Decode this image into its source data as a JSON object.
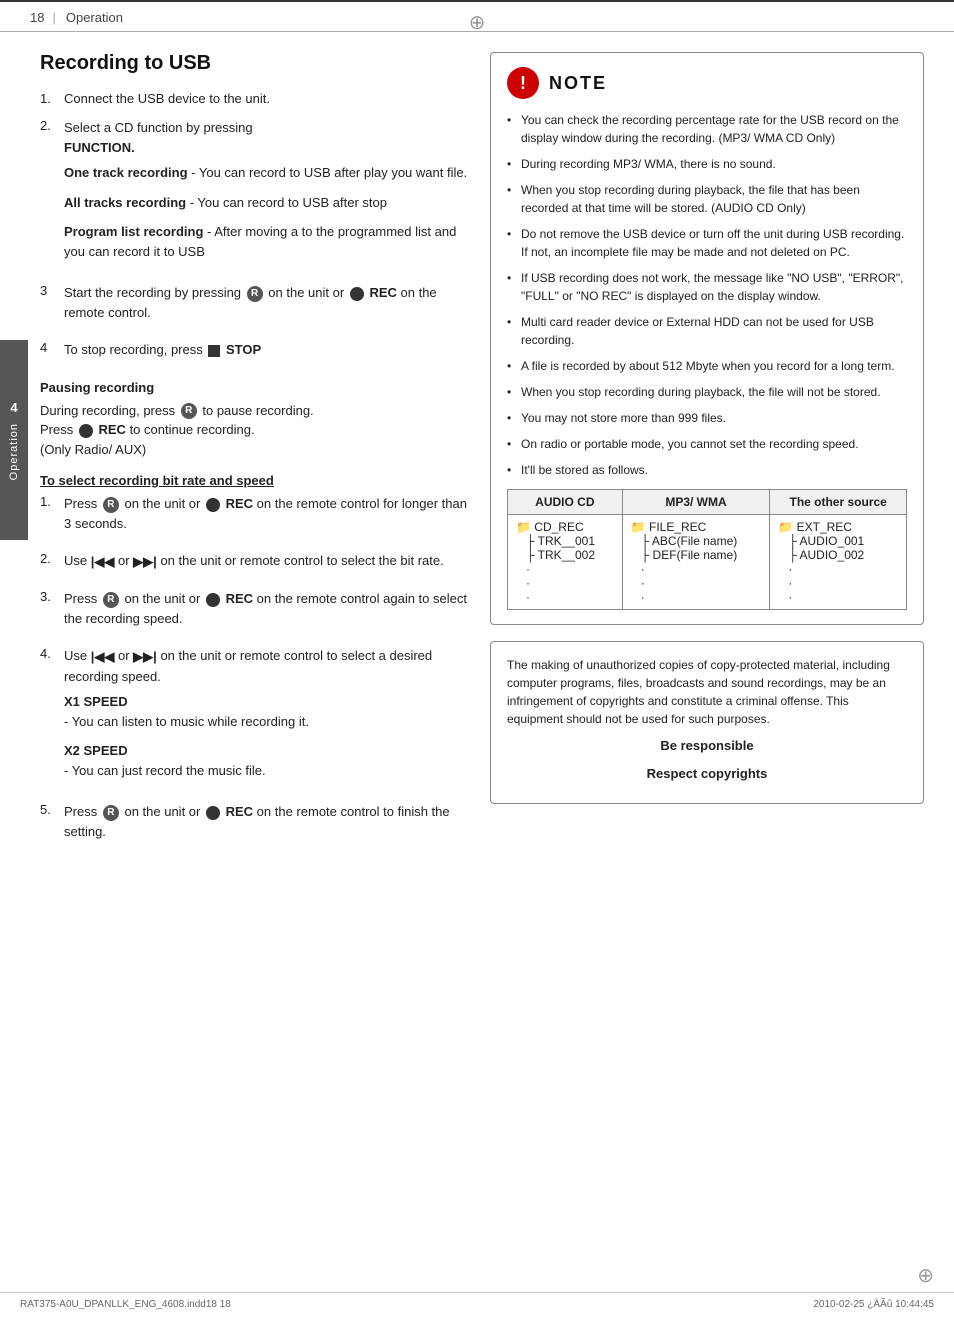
{
  "header": {
    "page_num": "18",
    "title": "Operation"
  },
  "sidebar": {
    "chapter_num": "4",
    "chapter_label": "Operation"
  },
  "left_col": {
    "section_title": "Recording to USB",
    "steps": [
      {
        "num": "1.",
        "text": "Connect the USB device to the unit."
      },
      {
        "num": "2.",
        "text": "Select a CD function by pressing",
        "bold": "FUNCTION.",
        "sub_items": [
          {
            "label": "One track recording",
            "desc": " - You can record to USB after play you want file."
          },
          {
            "label": "All tracks recording",
            "desc": " - You can record to USB after stop"
          },
          {
            "label": "Program list recording",
            "desc": " - After moving a to the programmed list and you can record it to USB"
          }
        ]
      },
      {
        "num": "3",
        "text_before": "Start the recording by pressing",
        "icon": "R",
        "text_after": "on the unit or",
        "icon2": "●",
        "bold2": "REC",
        "text_end": "on the remote control."
      },
      {
        "num": "4",
        "text_before": "To stop recording, press",
        "icon": "■",
        "bold": "STOP"
      }
    ],
    "pausing_heading": "Pausing recording",
    "pausing_text1_before": "During recording, press",
    "pausing_icon": "R",
    "pausing_text1_after": "to pause recording.",
    "pausing_text2_before": "Press",
    "pausing_icon2": "●",
    "pausing_bold2": "REC",
    "pausing_text2_after": "to continue recording.",
    "pausing_text3": "(Only Radio/ AUX)",
    "bitrate_heading": "To select recording bit rate and speed",
    "bitrate_steps": [
      {
        "num": "1.",
        "text_before": "Press",
        "icon": "R",
        "text_mid": "on the unit or",
        "icon2": "●",
        "bold2": "REC",
        "text_after": "on the remote control for longer than 3 seconds."
      },
      {
        "num": "2.",
        "text_before": "Use",
        "icon_skip1": "◀◀",
        "text_mid": "or",
        "icon_skip2": "▶▶",
        "text_after": "on the unit or remote control to select the bit rate."
      },
      {
        "num": "3.",
        "text_before": "Press",
        "icon": "R",
        "text_mid": "on the unit or",
        "icon2": "●",
        "bold2": "REC",
        "text_after": "on the remote control again to select the recording speed."
      },
      {
        "num": "4.",
        "text_before": "Use",
        "icon_skip1": "◀◀",
        "text_mid": "or",
        "icon_skip2": "▶▶",
        "text_after": "on the unit or remote control to select a desired recording speed.",
        "sub": [
          {
            "label": "X1 SPEED",
            "desc": "- You can listen to music while recording it."
          },
          {
            "label": "X2 SPEED",
            "desc": "- You can just record the music file."
          }
        ]
      },
      {
        "num": "5.",
        "text_before": "Press",
        "icon": "R",
        "text_mid": "on the unit or",
        "icon2": "●",
        "bold2": "REC",
        "text_after": "on the remote control to finish the setting."
      }
    ]
  },
  "note_box": {
    "title": "NOTE",
    "items": [
      "You can check the recording percentage rate for the USB record on the display window during the recording. (MP3/ WMA CD Only)",
      "During recording MP3/ WMA, there is no sound.",
      "When you stop recording during playback, the file that has been recorded at that time will be stored. (AUDIO CD Only)",
      "Do not remove the USB device or turn off the unit during USB recording. If not, an incomplete file may be made and not deleted on PC.",
      "If USB recording does not work, the message like \"NO USB\", \"ERROR\", \"FULL\" or \"NO REC\" is displayed on the display window.",
      "Multi card reader device or External HDD can not be used for USB recording.",
      "A file is recorded by about 512 Mbyte when you record for a long term.",
      "When you stop recording during playback, the file will not be stored.",
      "You may not store more than 999 files.",
      "On radio or portable mode, you cannot set the recording speed.",
      "It'll be stored as follows."
    ]
  },
  "file_table": {
    "headers": [
      "AUDIO CD",
      "MP3/ WMA",
      "The other source"
    ],
    "rows": [
      {
        "col1_folder": "CD_REC",
        "col1_items": [
          "TRK__001",
          "TRK__002",
          "·",
          "·",
          "·"
        ],
        "col2_folder": "FILE_REC",
        "col2_items": [
          "ABC(File name)",
          "DEF(File name)",
          "·",
          "·",
          "·"
        ],
        "col3_folder": "EXT_REC",
        "col3_items": [
          "AUDIO_001",
          "AUDIO_002",
          "·",
          "·",
          "·"
        ]
      }
    ]
  },
  "copyright_box": {
    "text": "The making of unauthorized copies of copy-protected material, including computer programs, files, broadcasts and sound recordings, may be an infringement of copyrights and constitute a criminal offense. This equipment should not be used for such purposes.",
    "bold_line1": "Be responsible",
    "bold_line2": "Respect copyrights"
  },
  "footer": {
    "left": "RAT375-A0U_DPANLLK_ENG_4608.indd18   18",
    "right": "2010-02-25   ¿ÀÃû 10:44:45"
  }
}
